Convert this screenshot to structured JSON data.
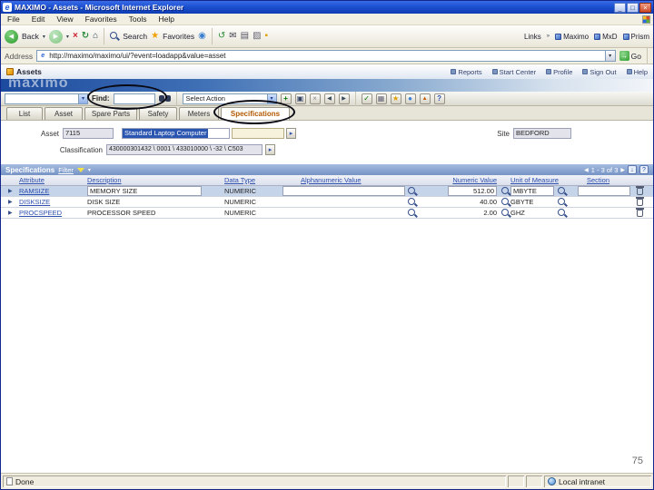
{
  "window": {
    "title": "MAXIMO - Assets - Microsoft Internet Explorer"
  },
  "menu_bar": {
    "items": [
      "File",
      "Edit",
      "View",
      "Favorites",
      "Tools",
      "Help"
    ]
  },
  "ie_toolbar": {
    "back_label": "Back",
    "search_label": "Search",
    "favorites_label": "Favorites",
    "links_label": "Links",
    "link_items": [
      "Maximo",
      "MxD",
      "Prism"
    ]
  },
  "address_bar": {
    "label": "Address",
    "url": "http://maximo/maximo/ui/?event=loadapp&value=asset",
    "go_label": "Go"
  },
  "app_header": {
    "app_title": "Assets",
    "brand_watermark": "maximo",
    "nav_links": [
      "Reports",
      "Start Center",
      "Profile",
      "Sign Out",
      "Help"
    ]
  },
  "find_toolbar": {
    "find_label": "Find:",
    "find_value": "",
    "select_action_label": "Select Action"
  },
  "tabs": {
    "items": [
      "List",
      "Asset",
      "Spare Parts",
      "Safety",
      "Meters",
      "Specifications"
    ],
    "active_tab": "Specifications"
  },
  "asset_form": {
    "asset_label": "Asset",
    "asset_value": "7115",
    "asset_description": "Standard Laptop Computer",
    "long_description_value": "",
    "site_label": "Site",
    "site_value": "BEDFORD",
    "classification_label": "Classification",
    "classification_value": "430000301432 \\ 0001 \\ 433010000 \\ -32 \\ C503"
  },
  "specifications": {
    "section_title": "Specifications",
    "filter_label": "Filter",
    "pagination": "1 - 3 of 3",
    "columns": {
      "attribute": "Attribute",
      "description": "Description",
      "data_type": "Data Type",
      "alphanumeric_value": "Alphanumeric Value",
      "numeric_value": "Numeric Value",
      "unit_of_measure": "Unit of Measure",
      "section": "Section"
    },
    "rows": [
      {
        "attribute": "RAMSIZE",
        "description": "MEMORY SIZE",
        "data_type": "NUMERIC",
        "alphanumeric_value": "",
        "numeric_value": "512.00",
        "unit_of_measure": "MBYTE",
        "section": ""
      },
      {
        "attribute": "DISKSIZE",
        "description": "DISK SIZE",
        "data_type": "NUMERIC",
        "alphanumeric_value": "",
        "numeric_value": "40.00",
        "unit_of_measure": "GBYTE",
        "section": ""
      },
      {
        "attribute": "PROCSPEED",
        "description": "PROCESSOR SPEED",
        "data_type": "NUMERIC",
        "alphanumeric_value": "",
        "numeric_value": "2.00",
        "unit_of_measure": "GHZ",
        "section": ""
      }
    ]
  },
  "status_bar": {
    "status": "Done",
    "zone": "Local intranet"
  },
  "slide": {
    "page_number": "75"
  },
  "icons": {
    "minimize": "_",
    "maximize": "□",
    "close": "×",
    "back": "◀",
    "forward": "▶",
    "stop": "×",
    "refresh": "↻",
    "home": "⌂",
    "favorites": "★",
    "media": "◉",
    "history": "↺",
    "mail": "✉",
    "print": "▤",
    "edit": "▨",
    "messenger": "▪",
    "dropdown": "▾",
    "go": "→",
    "links_chevron": "»",
    "insert_row": "+",
    "save": "▣",
    "clear_changes": "×",
    "previous_row": "◀",
    "next_row": "▶",
    "change_status": "✓",
    "run_reports": "▦",
    "bookmarks": "★",
    "attachments": "●",
    "kpi": "▲",
    "toolbar_help": "?",
    "prev_page": "◀",
    "next_page": "▶",
    "download": "↓",
    "table_help": "?",
    "row_arrow": "▶",
    "detail_menu": "▸"
  }
}
